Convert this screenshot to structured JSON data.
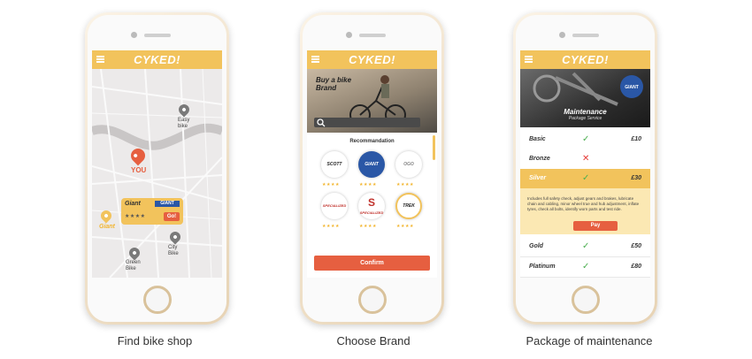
{
  "captions": [
    "Find bike shop",
    "Choose Brand",
    "Package of maintenance"
  ],
  "app": {
    "logo": "CYKED!"
  },
  "map": {
    "you_label": "YOU",
    "shops": [
      {
        "name": "Easy bike"
      },
      {
        "name": "City Bike"
      },
      {
        "name": "Green Bike"
      }
    ],
    "popup": {
      "shop": "Giant",
      "brand": "GIANT",
      "stars": "★★★★",
      "go_label": "Go!"
    },
    "giant_pin_label": "Giant",
    "colors": {
      "accent": "#f2c35c",
      "you": "#e65f40",
      "shop_pin": "#7a7a7a"
    }
  },
  "brand": {
    "hero_title": "Buy a bike Brand",
    "section_title": "Recommandation",
    "brands": [
      {
        "name": "SCOTT",
        "stars": "★★★★"
      },
      {
        "name": "GIANT",
        "stars": "★★★★"
      },
      {
        "name": "OGO",
        "stars": "★★★★"
      },
      {
        "name": "SPECIALIZED",
        "stars": "★★★★"
      },
      {
        "name": "SPECIALIZED",
        "stars": "★★★★"
      },
      {
        "name": "TREK",
        "stars": "★★★★"
      }
    ],
    "confirm_label": "Confirm"
  },
  "maintenance": {
    "title": "Maintenance",
    "subtitle": "Package Service",
    "packages": [
      {
        "name": "Basic",
        "mark": "✓",
        "price": "£10"
      },
      {
        "name": "Bronze",
        "mark": "✕",
        "price": ""
      },
      {
        "name": "Silver",
        "mark": "✓",
        "price": "£30"
      },
      {
        "name": "Gold",
        "mark": "✓",
        "price": "£50"
      },
      {
        "name": "Platinum",
        "mark": "✓",
        "price": "£80"
      }
    ],
    "silver_detail": "Includes full safety check, adjust gears and brakes, lubricate chain and cabling, minor wheel true and hub adjustment, inflate tyres, check all bolts, identify worn parts and test ride.",
    "pay_label": "Pay"
  }
}
